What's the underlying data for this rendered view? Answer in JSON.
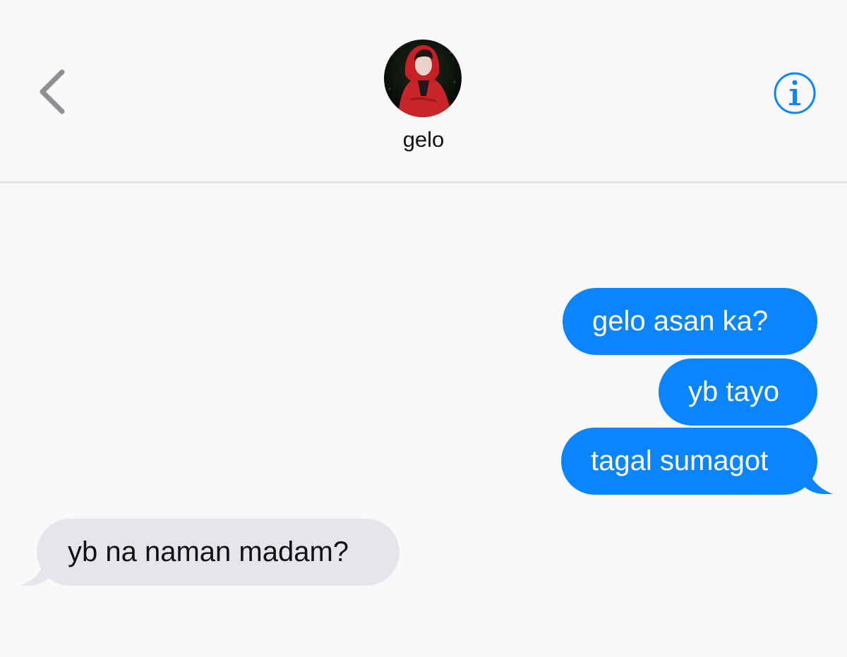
{
  "header": {
    "contact_name": "gelo",
    "back_icon": "chevron-left-icon",
    "info_icon": "info-icon",
    "accent_color": "#0a84ff"
  },
  "messages": [
    {
      "direction": "sent",
      "text": "gelo asan ka?"
    },
    {
      "direction": "sent",
      "text": "yb tayo"
    },
    {
      "direction": "sent",
      "text": "tagal sumagot"
    },
    {
      "direction": "received",
      "text": "yb na naman madam?"
    }
  ],
  "colors": {
    "sent_bubble": "#0a84ff",
    "received_bubble": "#e6e5eb",
    "background": "#f9f9f9"
  }
}
